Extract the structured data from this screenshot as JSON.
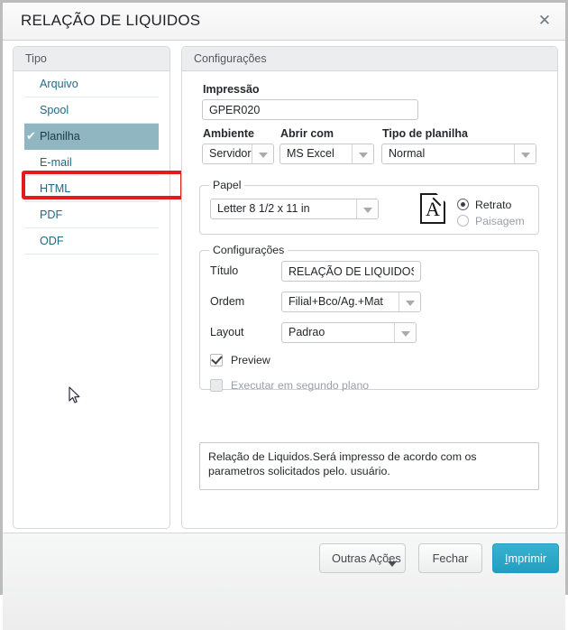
{
  "window": {
    "title": "RELAÇÃO DE LIQUIDOS",
    "close_icon": "close-icon",
    "close_glyph": "✕"
  },
  "sidebar": {
    "header": "Tipo",
    "selected_index": 2,
    "check_glyph": "✔",
    "items": [
      {
        "label": "Arquivo"
      },
      {
        "label": "Spool"
      },
      {
        "label": "Planilha"
      },
      {
        "label": "E-mail"
      },
      {
        "label": "HTML"
      },
      {
        "label": "PDF"
      },
      {
        "label": "ODF"
      }
    ]
  },
  "main": {
    "header": "Configurações",
    "impressao": {
      "label": "Impressão",
      "value": "GPER020"
    },
    "ambiente": {
      "label": "Ambiente",
      "value": "Servidor"
    },
    "abrir_com": {
      "label": "Abrir com",
      "value": "MS Excel"
    },
    "tipo_planilha": {
      "label": "Tipo de planilha",
      "value": "Normal"
    },
    "papel": {
      "legend": "Papel",
      "size_value": "Letter 8 1/2 x 11 in",
      "page_icon_glyph": "A",
      "orientation": [
        {
          "label": "Retrato",
          "selected": true,
          "disabled": false
        },
        {
          "label": "Paisagem",
          "selected": false,
          "disabled": true
        }
      ]
    },
    "configuracoes": {
      "legend": "Configurações",
      "titulo": {
        "label": "Título",
        "value": "RELAÇÃO DE LIQUIDOS"
      },
      "ordem": {
        "label": "Ordem",
        "value": "Filial+Bco/Ag.+Mat"
      },
      "layout": {
        "label": "Layout",
        "value": "Padrao"
      },
      "preview": {
        "label": "Preview",
        "checked": true
      },
      "segundo_plano": {
        "label": "Executar em segundo plano",
        "checked": false
      }
    },
    "description": "Relação de Liquidos.Será impresso de acordo com os parametros solicitados pelo. usuário."
  },
  "footer": {
    "outras_acoes": "Outras Ações",
    "fechar": "Fechar",
    "imprimir_accel": "I",
    "imprimir_rest": "mprimir"
  },
  "colors": {
    "accent": "#219ec0",
    "link": "#1b6c86",
    "selected_row": "#8fb6c1",
    "highlight_box": "#e31b19"
  }
}
